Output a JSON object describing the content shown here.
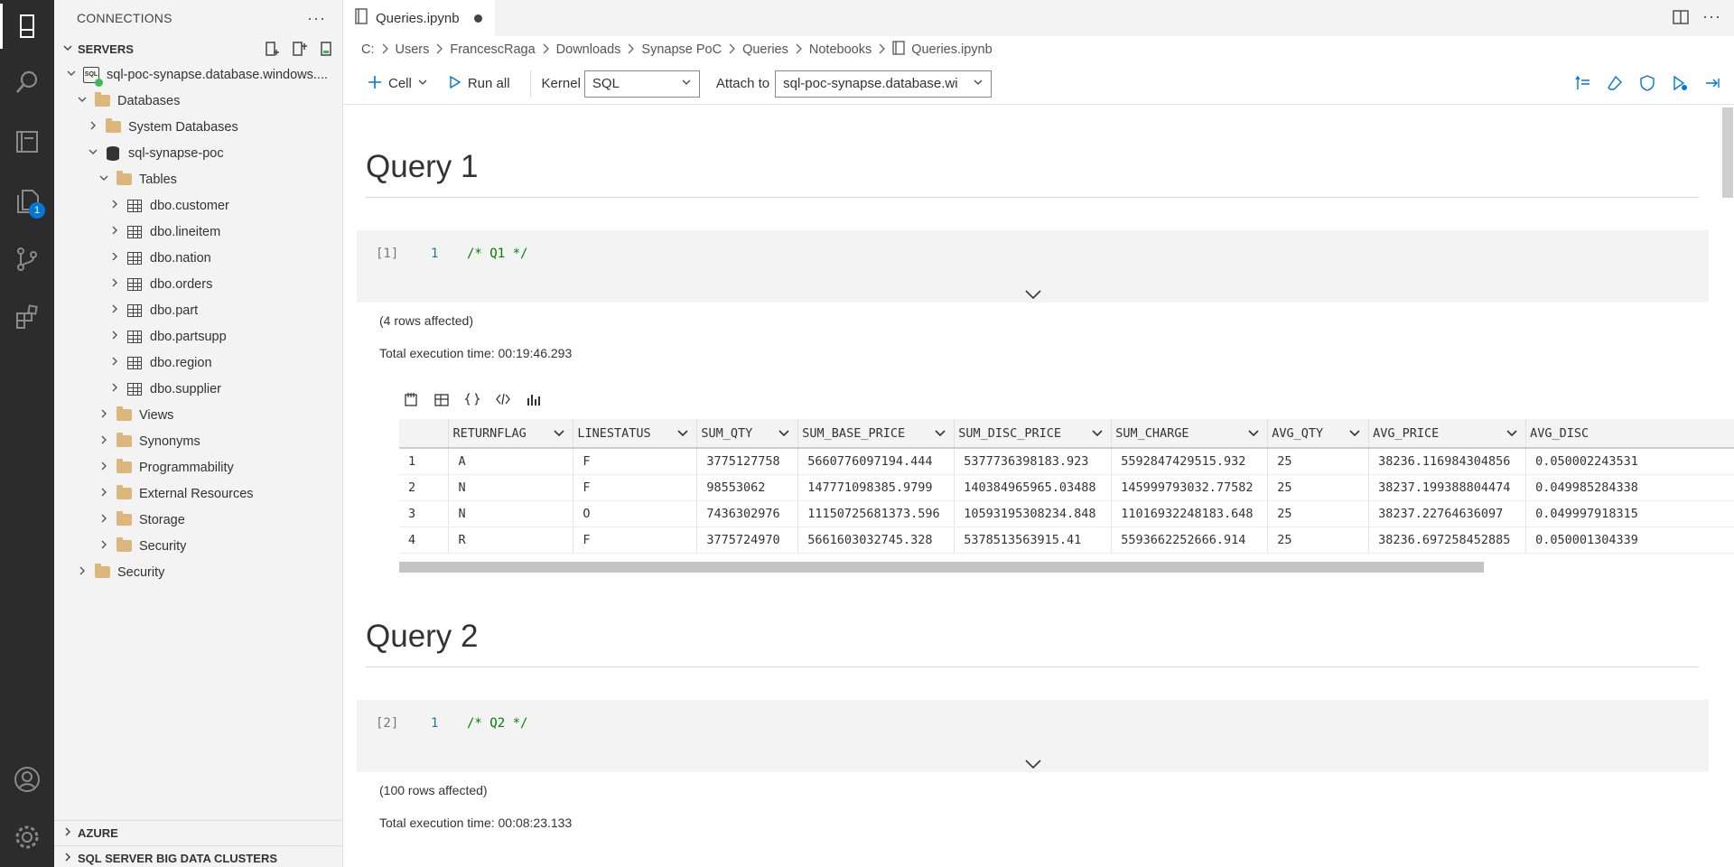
{
  "activity_bar": {
    "items": [
      {
        "name": "connections-icon"
      },
      {
        "name": "search-icon"
      },
      {
        "name": "notebooks-icon"
      },
      {
        "name": "explorer-icon",
        "badge": "1"
      },
      {
        "name": "source-control-icon"
      },
      {
        "name": "extensions-icon"
      }
    ],
    "bottom": [
      {
        "name": "account-icon"
      },
      {
        "name": "settings-gear-icon"
      }
    ]
  },
  "sidebar": {
    "title": "CONNECTIONS",
    "servers_label": "SERVERS",
    "tree": [
      {
        "label": "sql-poc-synapse.database.windows....",
        "type": "server",
        "level": 0,
        "expanded": true
      },
      {
        "label": "Databases",
        "type": "folder",
        "level": 1,
        "expanded": true
      },
      {
        "label": "System Databases",
        "type": "folder",
        "level": 2,
        "expanded": false
      },
      {
        "label": "sql-synapse-poc",
        "type": "database",
        "level": 2,
        "expanded": true
      },
      {
        "label": "Tables",
        "type": "folder",
        "level": 3,
        "expanded": true
      },
      {
        "label": "dbo.customer",
        "type": "table",
        "level": 4,
        "expanded": false
      },
      {
        "label": "dbo.lineitem",
        "type": "table",
        "level": 4,
        "expanded": false
      },
      {
        "label": "dbo.nation",
        "type": "table",
        "level": 4,
        "expanded": false
      },
      {
        "label": "dbo.orders",
        "type": "table",
        "level": 4,
        "expanded": false
      },
      {
        "label": "dbo.part",
        "type": "table",
        "level": 4,
        "expanded": false
      },
      {
        "label": "dbo.partsupp",
        "type": "table",
        "level": 4,
        "expanded": false
      },
      {
        "label": "dbo.region",
        "type": "table",
        "level": 4,
        "expanded": false
      },
      {
        "label": "dbo.supplier",
        "type": "table",
        "level": 4,
        "expanded": false
      },
      {
        "label": "Views",
        "type": "folder",
        "level": 3,
        "expanded": false
      },
      {
        "label": "Synonyms",
        "type": "folder",
        "level": 3,
        "expanded": false
      },
      {
        "label": "Programmability",
        "type": "folder",
        "level": 3,
        "expanded": false
      },
      {
        "label": "External Resources",
        "type": "folder",
        "level": 3,
        "expanded": false
      },
      {
        "label": "Storage",
        "type": "folder",
        "level": 3,
        "expanded": false
      },
      {
        "label": "Security",
        "type": "folder",
        "level": 3,
        "expanded": false
      },
      {
        "label": "Security",
        "type": "folder",
        "level": 1,
        "expanded": false
      }
    ],
    "azure_label": "AZURE",
    "bdc_label": "SQL SERVER BIG DATA CLUSTERS"
  },
  "tab": {
    "title": "Queries.ipynb"
  },
  "breadcrumb": [
    "C:",
    "Users",
    "FrancescRaga",
    "Downloads",
    "Synapse PoC",
    "Queries",
    "Notebooks",
    "Queries.ipynb"
  ],
  "toolbar": {
    "cell_label": "Cell",
    "run_all_label": "Run all",
    "kernel_label": "Kernel",
    "kernel_value": "SQL",
    "attach_label": "Attach to",
    "attach_value": "sql-poc-synapse.database.wi"
  },
  "notebook": {
    "query1": {
      "title": "Query 1",
      "exec_count": "[1]",
      "line_no": "1",
      "code": "/* Q1 */",
      "rows_affected": "(4 rows affected)",
      "exec_time": "Total execution time: 00:19:46.293",
      "columns": [
        "RETURNFLAG",
        "LINESTATUS",
        "SUM_QTY",
        "SUM_BASE_PRICE",
        "SUM_DISC_PRICE",
        "SUM_CHARGE",
        "AVG_QTY",
        "AVG_PRICE",
        "AVG_DISC"
      ],
      "rows": [
        [
          "1",
          "A",
          "F",
          "3775127758",
          "5660776097194.444",
          "5377736398183.923",
          "5592847429515.932",
          "25",
          "38236.116984304856",
          "0.050002243531"
        ],
        [
          "2",
          "N",
          "F",
          "98553062",
          "147771098385.9799",
          "140384965965.03488",
          "145999793032.77582",
          "25",
          "38237.199388804474",
          "0.049985284338"
        ],
        [
          "3",
          "N",
          "O",
          "7436302976",
          "11150725681373.596",
          "10593195308234.848",
          "11016932248183.648",
          "25",
          "38237.22764636097",
          "0.049997918315"
        ],
        [
          "4",
          "R",
          "F",
          "3775724970",
          "5661603032745.328",
          "5378513563915.41",
          "5593662252666.914",
          "25",
          "38236.697258452885",
          "0.050001304339"
        ]
      ]
    },
    "query2": {
      "title": "Query 2",
      "exec_count": "[2]",
      "line_no": "1",
      "code": "/* Q2 */",
      "rows_affected": "(100 rows affected)",
      "exec_time": "Total execution time: 00:08:23.133"
    }
  }
}
